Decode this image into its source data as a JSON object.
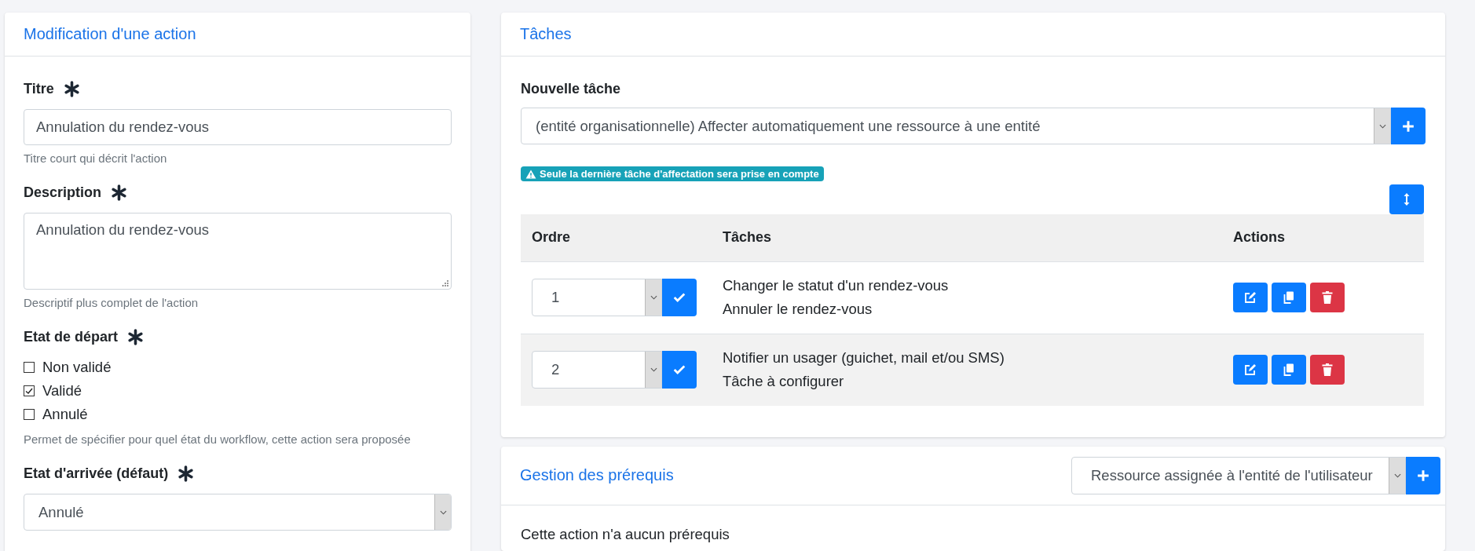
{
  "action_card": {
    "title": "Modification d'une action",
    "fields": [
      {
        "kind": "text",
        "label": "Titre",
        "required": true,
        "value": "Annulation du rendez-vous",
        "help": "Titre court qui décrit l'action"
      },
      {
        "kind": "textarea",
        "label": "Description",
        "required": true,
        "value": "Annulation du rendez-vous",
        "help": "Descriptif plus complet de l'action"
      },
      {
        "kind": "checkboxes",
        "label": "Etat de départ",
        "required": true,
        "options": [
          {
            "label": "Non validé",
            "checked": false
          },
          {
            "label": "Validé",
            "checked": true
          },
          {
            "label": "Annulé",
            "checked": false
          }
        ],
        "help": "Permet de spécifier pour quel état du workflow, cette action sera proposée"
      },
      {
        "kind": "select",
        "label": "Etat d'arrivée (défaut)",
        "required": true,
        "value": "Annulé"
      }
    ]
  },
  "tasks_card": {
    "title": "Tâches",
    "new_task_label": "Nouvelle tâche",
    "new_task_value": "(entité organisationnelle) Affecter automatiquement une ressource à une entité",
    "warning": "Seule la dernière tâche d'affectation sera prise en compte",
    "table": {
      "columns": [
        "Ordre",
        "Tâches",
        "Actions"
      ],
      "rows": [
        {
          "order": "1",
          "lines": [
            "Changer le statut d'un rendez-vous",
            "Annuler le rendez-vous"
          ]
        },
        {
          "order": "2",
          "lines": [
            "Notifier un usager (guichet, mail et/ou SMS)",
            "Tâche à configurer"
          ]
        }
      ]
    }
  },
  "prerequisites_card": {
    "title": "Gestion des prérequis",
    "select_value": "Ressource assignée à l'entité de l'utilisateur",
    "message": "Cette action n'a aucun prérequis"
  }
}
